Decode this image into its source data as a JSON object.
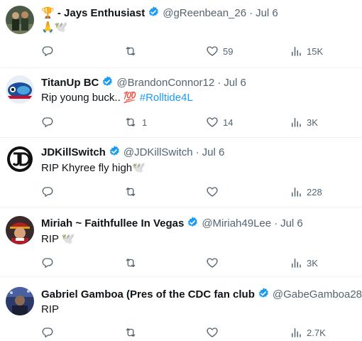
{
  "tweets": [
    {
      "name": "🏆 - Jays Enthusiast",
      "handle": "@gReenbean_26",
      "dot": "·",
      "time": "Jul 6",
      "text": "🙏🕊️",
      "hashtag": "",
      "replies": "",
      "retweets": "",
      "likes": "59",
      "views": "15K",
      "avatar_color": "#3d5a3a"
    },
    {
      "name": "TitanUp BC",
      "handle": "@BrandonConnor12",
      "dot": "·",
      "time": "Jul 6",
      "text": "Rip young buck.. 💯 ",
      "hashtag": "#Rolltide4L",
      "replies": "",
      "retweets": "1",
      "likes": "14",
      "views": "3K",
      "avatar_color": "#1c4e9c"
    },
    {
      "name": "JDKillSwitch",
      "handle": "@JDKillSwitch",
      "dot": "·",
      "time": "Jul 6",
      "text": "RIP Khyree fly high🕊️",
      "hashtag": "",
      "replies": "",
      "retweets": "",
      "likes": "",
      "views": "228",
      "avatar_color": "#111111"
    },
    {
      "name": "Miriah ~ Faithfullee In Vegas",
      "handle": "@Miriah49Lee",
      "dot": "·",
      "time": "Jul 6",
      "text": "RIP 🕊️",
      "hashtag": "",
      "replies": "",
      "retweets": "",
      "likes": "",
      "views": "3K",
      "avatar_color": "#b01e23"
    },
    {
      "name": "Gabriel Gamboa (Pres of the CDC fan club",
      "handle": "@GabeGamboa28",
      "dot": "·",
      "time": "",
      "text": "RIP",
      "hashtag": "",
      "replies": "",
      "retweets": "",
      "likes": "",
      "views": "2.7K",
      "avatar_color": "#2b3a6b"
    }
  ],
  "colors": {
    "verified": "#1d9bf0",
    "muted": "#536471",
    "link": "#1d9bf0"
  },
  "icons": [
    "reply-icon",
    "retweet-icon",
    "like-icon",
    "views-icon",
    "verified-badge-icon"
  ]
}
